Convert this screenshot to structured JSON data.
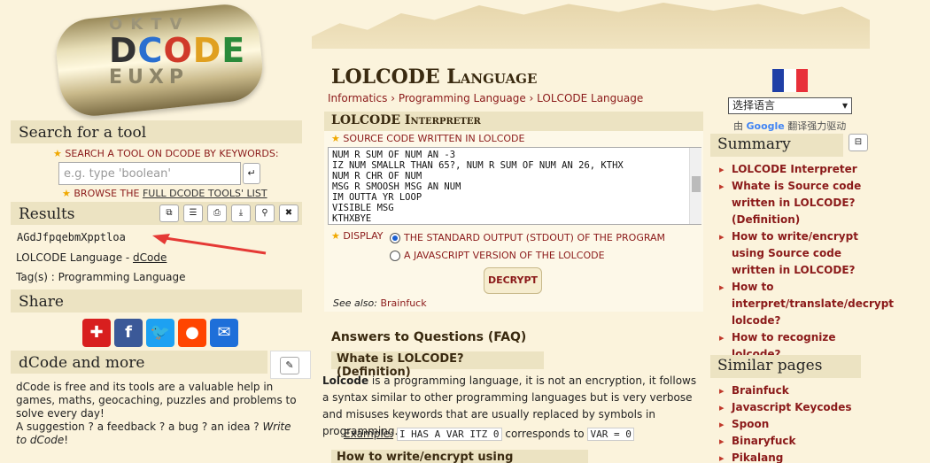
{
  "logo": {
    "top_row": "OKTV",
    "letters": [
      "D",
      "C",
      "O",
      "D",
      "E"
    ],
    "bottom_row": "EUXP"
  },
  "search": {
    "title": "Search for a tool",
    "keywords_label": "SEARCH A TOOL ON DCODE BY KEYWORDS:",
    "placeholder": "e.g. type 'boolean'",
    "browse_prefix": "BROWSE THE ",
    "browse_link": "FULL DCODE TOOLS' LIST"
  },
  "results": {
    "title": "Results",
    "value": "AGdJfpqebmXpptloa",
    "lang_prefix": "LOLCODE Language - ",
    "lang_link": "dCode",
    "tags": "Tag(s) : Programming Language"
  },
  "share": {
    "title": "Share"
  },
  "more": {
    "title": "dCode and more",
    "text": "dCode is free and its tools are a valuable help in games, maths, geocaching, puzzles and problems to solve every day!",
    "suggestion": "A suggestion ? a feedback ? a bug ? an idea ? ",
    "write_to": "Write to dCode",
    "end": "!"
  },
  "page": {
    "title": "LOLCODE Language",
    "breadcrumb": [
      "Informatics",
      "Programming Language",
      "LOLCODE Language"
    ]
  },
  "interpreter": {
    "title": "LOLCODE Interpreter",
    "source_label": "SOURCE CODE WRITTEN IN LOLCODE",
    "code": "NUM R SUM OF NUM AN -3\nIZ NUM SMALLR THAN 65?, NUM R SUM OF NUM AN 26, KTHX\nNUM R CHR OF NUM\nMSG R SMOOSH MSG AN NUM\nIM OUTTA YR LOOP\nVISIBLE MSG\nKTHXBYE",
    "display_label": "DISPLAY",
    "option1": "THE STANDARD OUTPUT (STDOUT) OF THE PROGRAM",
    "option2": "A JAVASCRIPT VERSION OF THE LOLCODE",
    "decrypt": "DECRYPT",
    "see_also_label": "See also:",
    "see_also_link": "Brainfuck"
  },
  "faq": {
    "title": "Answers to Questions (FAQ)",
    "q1": "Whate is LOLCODE? (Definition)",
    "a1_bold": "Lolcode",
    "a1": " is a programming language, it is not an encryption, it follows a syntax similar to other programming languages but is very verbose and misuses keywords that are usually replaced by symbols in programming.",
    "example_label": "Example:",
    "example_code1": "I HAS A VAR ITZ 0",
    "example_mid": "corresponds to",
    "example_code2": "VAR = 0",
    "q2": "How to write/encrypt using LOLCODE?"
  },
  "lang": {
    "selected": "选择语言",
    "powered": "由 ",
    "google": "Google",
    "translate": " 翻译强力驱动"
  },
  "summary": {
    "title": "Summary",
    "items": [
      "LOLCODE Interpreter",
      "Whate is Source code written in LOLCODE? (Definition)",
      "How to write/encrypt using Source code written in LOLCODE?",
      "How to interpret/translate/decrypt lolcode?",
      "How to recognize lolcode?"
    ]
  },
  "similar": {
    "title": "Similar pages",
    "items": [
      "Brainfuck",
      "Javascript Keycodes",
      "Spoon",
      "Binaryfuck",
      "Pikalang"
    ]
  },
  "colors": {
    "accent": "#8b1a1a",
    "panel": "#ece3c2",
    "bg": "#fbf3dc"
  }
}
